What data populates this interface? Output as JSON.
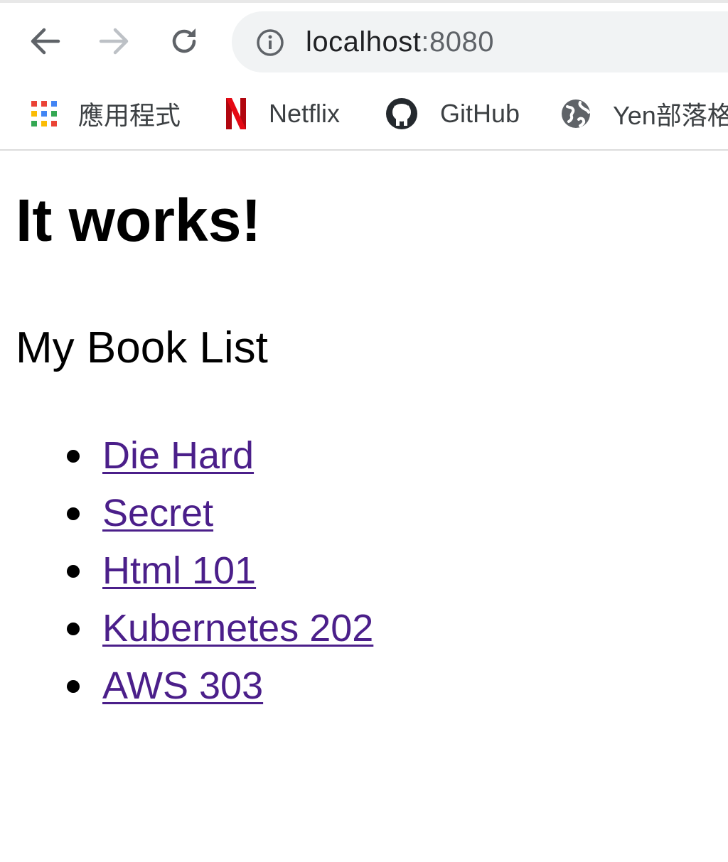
{
  "browser": {
    "url_host": "localhost",
    "url_port": ":8080",
    "bookmarks": [
      {
        "label": "應用程式",
        "icon": "apps-grid-icon"
      },
      {
        "label": "Netflix",
        "icon": "netflix-icon"
      },
      {
        "label": "GitHub",
        "icon": "github-icon"
      },
      {
        "label": "Yen部落格",
        "icon": "globe-icon"
      }
    ]
  },
  "page": {
    "title": "It works!",
    "subtitle": "My Book List",
    "books": [
      "Die Hard",
      "Secret",
      "Html 101",
      "Kubernetes 202",
      "AWS 303"
    ]
  },
  "colors": {
    "link_visited": "#4b1f8a",
    "omnibox_bg": "#f1f3f4",
    "netflix_red": "#e50914"
  }
}
